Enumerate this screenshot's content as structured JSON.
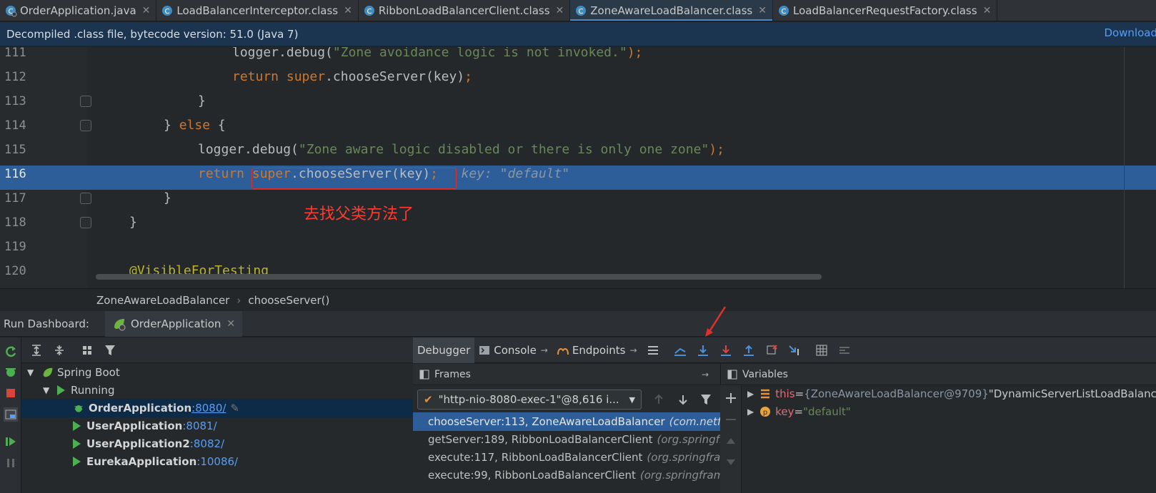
{
  "tabs": [
    {
      "label": "OrderApplication.java",
      "active": false
    },
    {
      "label": "LoadBalancerInterceptor.class",
      "active": false
    },
    {
      "label": "RibbonLoadBalancerClient.class",
      "active": false
    },
    {
      "label": "ZoneAwareLoadBalancer.class",
      "active": true
    },
    {
      "label": "LoadBalancerRequestFactory.class",
      "active": false
    }
  ],
  "infobar": {
    "text": "Decompiled .class file, bytecode version: 51.0 (Java 7)",
    "download": "Download"
  },
  "editor": {
    "lines": [
      "111",
      "112",
      "113",
      "114",
      "115",
      "116",
      "117",
      "118",
      "119",
      "120"
    ],
    "code": {
      "l111_a": "logger.debug(",
      "l111_s": "\"Zone avoidance logic is not invoked.\"",
      "l111_b": ");",
      "l112_kw": "return",
      "l112_sup": "super",
      "l112_rest": ".chooseServer(key)",
      "l112_semi": ";",
      "l113": "}",
      "l114_a": "} ",
      "l114_kw": "else",
      "l114_b": " {",
      "l115_a": "logger.debug(",
      "l115_s": "\"Zone aware logic disabled or there is only one zone\"",
      "l115_b": ");",
      "l116_kw": "return",
      "l116_sup": "super",
      "l116_rest": ".chooseServer(key)",
      "l116_semi": ";",
      "l116_hint": "key: \"default\"",
      "l117": "}",
      "l118": "}",
      "l120": "@VisibleForTesting"
    },
    "annotation_note": "去找父类方法了"
  },
  "breadcrumb": {
    "class": "ZoneAwareLoadBalancer",
    "method": "chooseServer()"
  },
  "run_dashboard": {
    "label": "Run Dashboard:",
    "tab": "OrderApplication"
  },
  "tree": {
    "spring_boot": "Spring Boot",
    "running": "Running",
    "apps": [
      {
        "name": "OrderApplication",
        "port": ":8080/"
      },
      {
        "name": "UserApplication",
        "port": ":8081/"
      },
      {
        "name": "UserApplication2",
        "port": ":8082/"
      },
      {
        "name": "EurekaApplication",
        "port": ":10086/"
      }
    ]
  },
  "debugger": {
    "tabs": {
      "debugger": "Debugger",
      "console": "Console",
      "endpoints": "Endpoints"
    },
    "frames_label": "Frames",
    "variables_label": "Variables",
    "thread": "\"http-nio-8080-exec-1\"@8,616 i...",
    "frames": [
      {
        "text": "chooseServer:113, ZoneAwareLoadBalancer",
        "pkg": "(com.netflix"
      },
      {
        "text": "getServer:189, RibbonLoadBalancerClient",
        "pkg": "(org.springfra"
      },
      {
        "text": "execute:117, RibbonLoadBalancerClient",
        "pkg": "(org.springfram"
      },
      {
        "text": "execute:99, RibbonLoadBalancerClient",
        "pkg": "(org.springframe"
      }
    ],
    "variables": {
      "this_name": "this",
      "eq": " = ",
      "this_val": "{ZoneAwareLoadBalancer@9709}",
      "this_str": " \"DynamicServerListLoadBalancer",
      "key_name": "key",
      "key_val": "\"default\""
    }
  },
  "colors": {
    "accent": "#4a88c7",
    "selection": "#2d5e9a",
    "annotation": "#ff3b30",
    "keyword": "#cc7832",
    "string": "#6a8759"
  }
}
